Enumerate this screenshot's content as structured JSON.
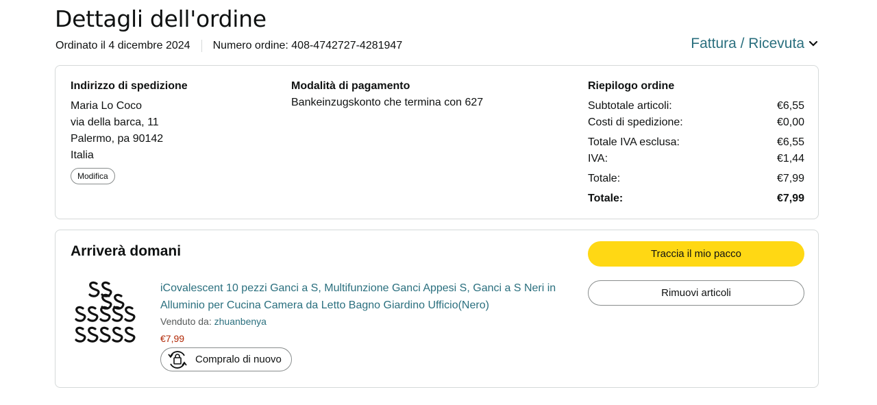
{
  "header": {
    "title": "Dettagli dell'ordine",
    "ordered_date": "Ordinato il 4 dicembre 2024",
    "order_number": "Numero ordine: 408-4742727-4281947",
    "invoice_link": "Fattura / Ricevuta"
  },
  "shipping": {
    "title": "Indirizzo di spedizione",
    "name": "Maria Lo Coco",
    "street": "via della barca, 11",
    "city": "Palermo, pa 90142",
    "country": "Italia",
    "edit_label": "Modifica"
  },
  "payment": {
    "title": "Modalità di pagamento",
    "method": "Bankeinzugskonto che termina con 627"
  },
  "summary": {
    "title": "Riepilogo ordine",
    "rows": [
      {
        "label": "Subtotale articoli:",
        "value": "€6,55"
      },
      {
        "label": "Costi di spedizione:",
        "value": "€0,00"
      },
      {
        "label": "Totale IVA esclusa:",
        "value": "€6,55"
      },
      {
        "label": "IVA:",
        "value": "€1,44"
      },
      {
        "label": "Totale:",
        "value": "€7,99"
      },
      {
        "label": "Totale:",
        "value": "€7,99"
      }
    ]
  },
  "shipment": {
    "title": "Arriverà domani",
    "product_title": "iCovalescent 10 pezzi Ganci a S, Multifunzione Ganci Appesi S, Ganci a S Neri in Alluminio per Cucina Camera da Letto Bagno Giardino Ufficio(Nero)",
    "sold_by_label": "Venduto da:",
    "seller": "zhuanbenya",
    "price": "€7,99",
    "buy_again_label": "Compralo di nuovo",
    "track_label": "Traccia il mio pacco",
    "remove_label": "Rimuovi articoli"
  },
  "icons": {
    "invoice_chevron": "chevron-down-icon",
    "buy_again": "buy-again-icon"
  },
  "colors": {
    "link": "#2a6f7e",
    "primary_button": "#ffd814",
    "price": "#b12704",
    "border": "#d5d9d9"
  }
}
